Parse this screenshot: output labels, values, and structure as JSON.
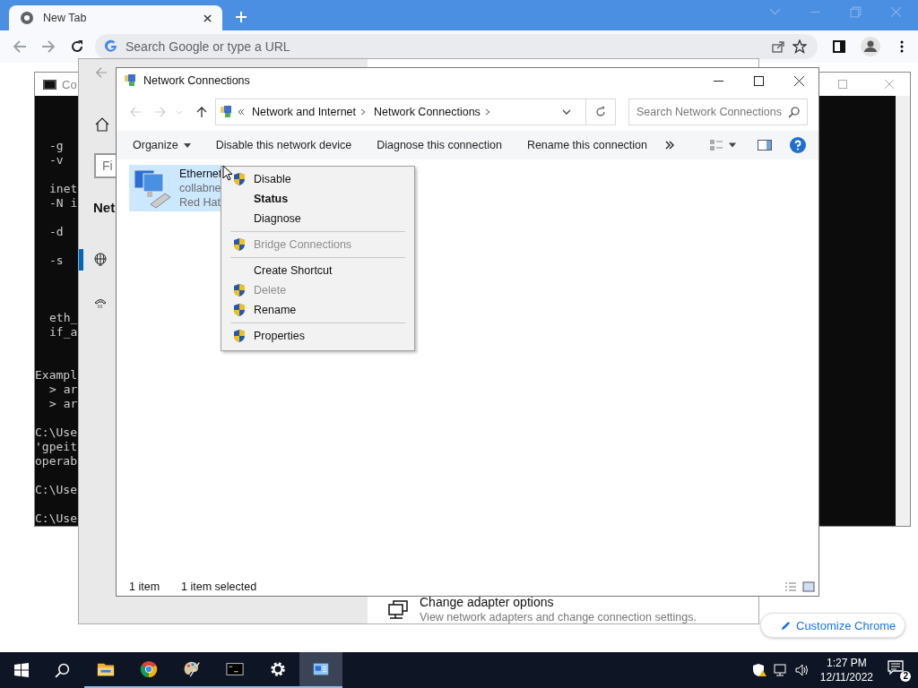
{
  "browser": {
    "tab": {
      "title": "New Tab",
      "selected": true
    },
    "omnibox": {
      "placeholder": "Search Google or type a URL"
    },
    "customize_button": "Customize Chrome"
  },
  "console": {
    "title": "Co",
    "blocks": [
      {
        "lines": [
          {
            "text": "-g",
            "indented": true
          },
          {
            "text": "-v",
            "indented": true
          }
        ]
      },
      {
        "lines": [
          {
            "text": "inet",
            "indented": true
          },
          {
            "text": "-N i",
            "indented": true
          }
        ]
      },
      {
        "lines": [
          {
            "text": "-d",
            "indented": true
          }
        ]
      },
      {
        "lines": [
          {
            "text": "-s",
            "indented": true
          }
        ]
      },
      {
        "lines": [
          {
            "text": "eth_",
            "indented": true
          },
          {
            "text": "if_a",
            "indented": true
          }
        ]
      },
      {
        "lines": [
          {
            "text": "Exampl",
            "indented": false
          },
          {
            "text": "> ar",
            "indented": true
          },
          {
            "text": "> ar",
            "indented": true
          }
        ]
      },
      {
        "lines": [
          {
            "text": "C:\\Use",
            "indented": false
          },
          {
            "text": "'gpeit",
            "indented": false
          },
          {
            "text": "operab",
            "indented": false
          }
        ]
      },
      {
        "lines": [
          {
            "text": "C:\\Use",
            "indented": false
          }
        ]
      },
      {
        "lines": [
          {
            "text": "C:\\Use",
            "indented": false
          }
        ]
      }
    ]
  },
  "settings": {
    "search_placeholder": "Fi",
    "heading": "Net",
    "nav": [
      {
        "kind": "globe",
        "selected": true
      },
      {
        "kind": "dialup",
        "selected": false
      }
    ],
    "link": "Change adapter options",
    "description": "View network adapters and change connection settings."
  },
  "explorer": {
    "title": "Network Connections",
    "breadcrumbs": [
      "Network and Internet",
      "Network Connections"
    ],
    "search": {
      "placeholder": "Search Network Connections"
    },
    "commands": [
      {
        "label": "Organize",
        "dropdown": true
      },
      {
        "label": "Disable this network device",
        "dropdown": false
      },
      {
        "label": "Diagnose this connection",
        "dropdown": false
      },
      {
        "label": "Rename this connection",
        "dropdown": false
      }
    ],
    "items": [
      {
        "name": "Ethernet",
        "details": [
          "collabne",
          "Red Hat"
        ],
        "selected": true
      }
    ],
    "context_menu": [
      {
        "kind": "item",
        "label": "Disable",
        "shield": true,
        "default": false,
        "disabled": false
      },
      {
        "kind": "item",
        "label": "Status",
        "shield": false,
        "default": true,
        "disabled": false
      },
      {
        "kind": "item",
        "label": "Diagnose",
        "shield": false,
        "default": false,
        "disabled": false
      },
      {
        "kind": "separator"
      },
      {
        "kind": "item",
        "label": "Bridge Connections",
        "shield": true,
        "default": false,
        "disabled": true
      },
      {
        "kind": "separator"
      },
      {
        "kind": "item",
        "label": "Create Shortcut",
        "shield": false,
        "default": false,
        "disabled": false
      },
      {
        "kind": "item",
        "label": "Delete",
        "shield": true,
        "default": false,
        "disabled": true
      },
      {
        "kind": "item",
        "label": "Rename",
        "shield": true,
        "default": false,
        "disabled": false
      },
      {
        "kind": "separator"
      },
      {
        "kind": "item",
        "label": "Properties",
        "shield": true,
        "default": false,
        "disabled": false
      }
    ],
    "status": [
      "1 item",
      "1 item selected"
    ]
  },
  "taskbar": {
    "apps": [
      {
        "kind": "folder",
        "running": true,
        "selected": false
      },
      {
        "kind": "chrome",
        "running": true,
        "selected": false
      },
      {
        "kind": "paint",
        "running": true,
        "selected": false
      },
      {
        "kind": "console",
        "running": true,
        "selected": false
      },
      {
        "kind": "gear",
        "running": true,
        "selected": false
      },
      {
        "kind": "network",
        "running": true,
        "selected": true
      }
    ],
    "time": "1:27 PM",
    "date": "12/11/2022",
    "notifications": "2"
  }
}
